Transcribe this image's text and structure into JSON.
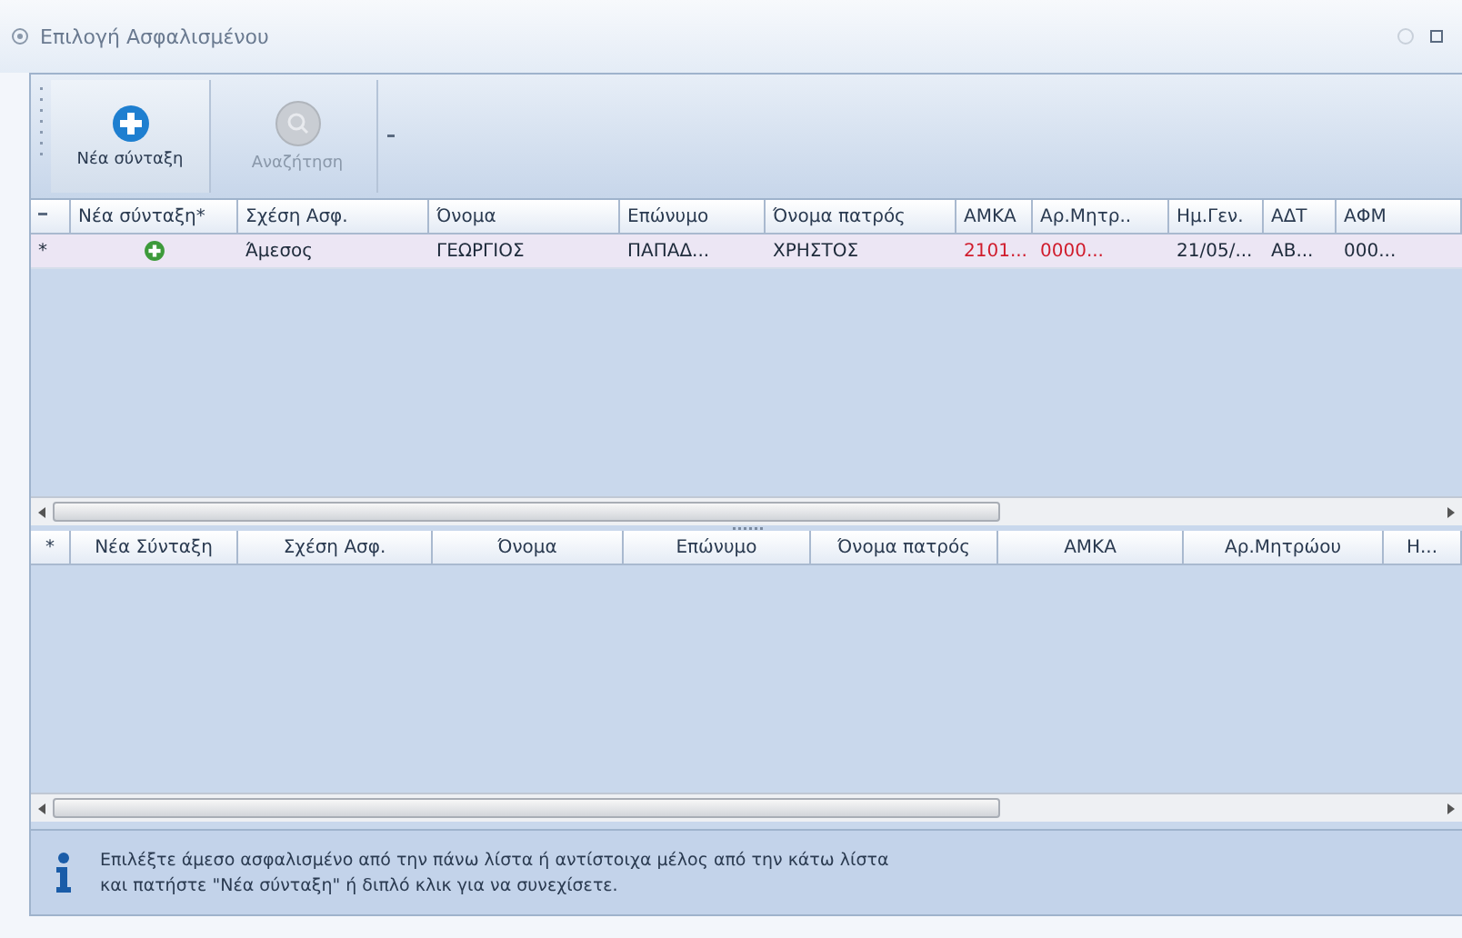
{
  "window": {
    "title": "Επιλογή Ασφαλισμένου"
  },
  "toolbar": {
    "buttons": [
      {
        "label": "Νέα σύνταξη",
        "kind": "add",
        "disabled": false
      },
      {
        "label": "Αναζήτηση",
        "kind": "search",
        "disabled": true
      }
    ]
  },
  "upper_grid": {
    "columns": [
      "Νέα σύνταξη*",
      "Σχέση Ασφ.",
      "Όνομα",
      "Επώνυμο",
      "Όνομα πατρός",
      "ΑΜΚΑ",
      "Αρ.Μητρ..",
      "Ημ.Γεν.",
      "ΑΔΤ",
      "ΑΦΜ"
    ],
    "rows": [
      {
        "indicator": "*",
        "selected": true,
        "cells": [
          {
            "kind": "add_icon",
            "text": ""
          },
          {
            "kind": "text",
            "text": "Άμεσος",
            "flagged": false
          },
          {
            "kind": "text",
            "text": "ΓΕΩΡΓΙΟΣ",
            "flagged": false
          },
          {
            "kind": "text",
            "text": "ΠΑΠΑΔ...",
            "flagged": false
          },
          {
            "kind": "text",
            "text": "ΧΡΗΣΤΟΣ",
            "flagged": false
          },
          {
            "kind": "text",
            "text": "2101...",
            "flagged": true
          },
          {
            "kind": "text",
            "text": "0000...",
            "flagged": true
          },
          {
            "kind": "text",
            "text": "21/05/...",
            "flagged": false
          },
          {
            "kind": "text",
            "text": "ΑΒ...",
            "flagged": false
          },
          {
            "kind": "text",
            "text": "000...",
            "flagged": false
          }
        ]
      }
    ]
  },
  "lower_grid": {
    "indicator": "*",
    "columns": [
      "Νέα Σύνταξη",
      "Σχέση Ασφ.",
      "Όνομα",
      "Επώνυμο",
      "Όνομα πατρός",
      "ΑΜΚΑ",
      "Αρ.Μητρώου",
      "Η..."
    ]
  },
  "info": {
    "lines": [
      "Επιλέξτε άμεσο ασφαλισμένο από την πάνω λίστα ή αντίστοιχα μέλος από την κάτω λίστα",
      "και πατήστε \"Νέα σύνταξη\" ή διπλό κλικ για να συνεχίσετε."
    ]
  }
}
